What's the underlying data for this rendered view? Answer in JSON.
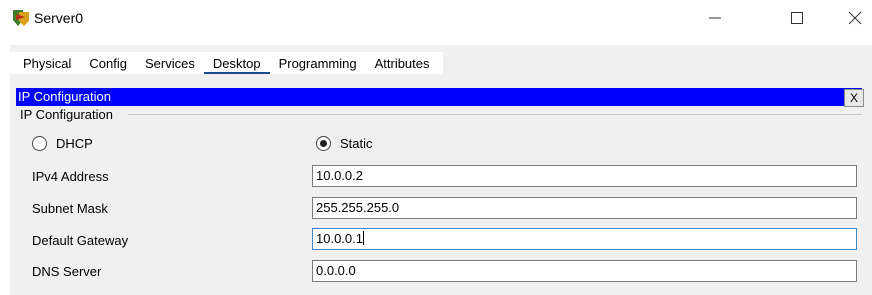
{
  "window": {
    "title": "Server0",
    "controls": {
      "minimize": "—",
      "maximize": "☐",
      "close": "✕"
    }
  },
  "tabs": [
    {
      "label": "Physical",
      "active": false
    },
    {
      "label": "Config",
      "active": false
    },
    {
      "label": "Services",
      "active": false
    },
    {
      "label": "Desktop",
      "active": true
    },
    {
      "label": "Programming",
      "active": false
    },
    {
      "label": "Attributes",
      "active": false
    }
  ],
  "panel": {
    "title": "IP Configuration",
    "close_label": "X",
    "group_label": "IP Configuration"
  },
  "mode": {
    "dhcp_label": "DHCP",
    "static_label": "Static",
    "selected": "Static"
  },
  "fields": [
    {
      "label": "IPv4 Address",
      "value": "10.0.0.2",
      "focused": false
    },
    {
      "label": "Subnet Mask",
      "value": "255.255.255.0",
      "focused": false
    },
    {
      "label": "Default Gateway",
      "value": "10.0.0.1",
      "focused": true
    },
    {
      "label": "DNS Server",
      "value": "0.0.0.0",
      "focused": false
    }
  ],
  "colors": {
    "panel_header": "#0000ff",
    "active_tab_underline": "#1a4b8c",
    "focus_border": "#3a86c8"
  }
}
